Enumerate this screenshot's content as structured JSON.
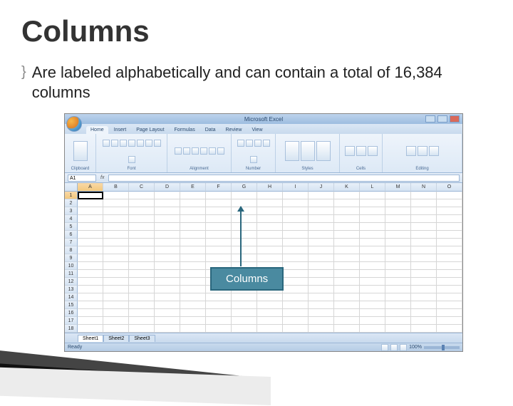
{
  "title": "Columns",
  "bullet_mark": "}",
  "body": "Are labeled alphabetically and can contain a total of 16,384 columns",
  "callout": "Columns",
  "excel": {
    "app_name": "Microsoft Excel",
    "tabs": [
      "Home",
      "Insert",
      "Page Layout",
      "Formulas",
      "Data",
      "Review",
      "View"
    ],
    "ribbon_groups": [
      "Clipboard",
      "Font",
      "Alignment",
      "Number",
      "Styles",
      "Cells",
      "Editing"
    ],
    "name_box": "A1",
    "fx": "fx",
    "columns": [
      "A",
      "B",
      "C",
      "D",
      "E",
      "F",
      "G",
      "H",
      "I",
      "J",
      "K",
      "L",
      "M",
      "N",
      "O"
    ],
    "rows": [
      "1",
      "2",
      "3",
      "4",
      "5",
      "6",
      "7",
      "8",
      "9",
      "10",
      "11",
      "12",
      "13",
      "14",
      "15",
      "16",
      "17",
      "18"
    ],
    "sheets": [
      "Sheet1",
      "Sheet2",
      "Sheet3"
    ],
    "paste_label": "Paste",
    "status": "Ready",
    "zoom": "100%"
  }
}
